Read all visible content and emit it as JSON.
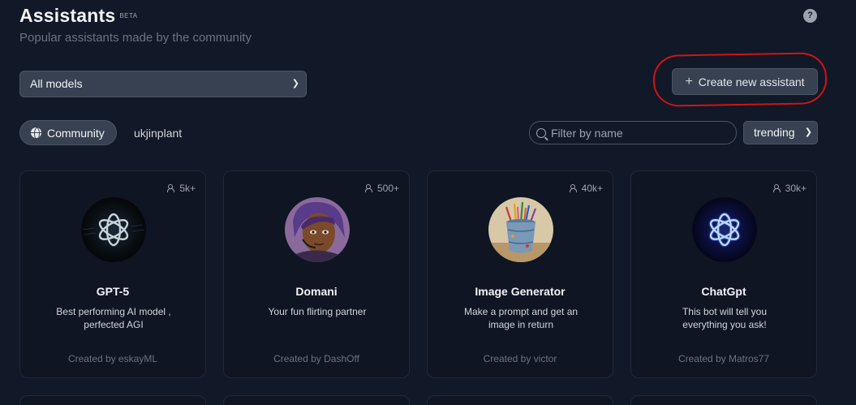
{
  "header": {
    "title": "Assistants",
    "beta": "BETA",
    "subtitle": "Popular assistants made by the community",
    "help_icon": "question-circle-icon"
  },
  "toolbar": {
    "models_select": "All models",
    "create_label": "Create new assistant"
  },
  "tabs": {
    "community": "Community",
    "user": "ukjinplant"
  },
  "filter": {
    "placeholder": "Filter by name",
    "sort": "trending"
  },
  "colors": {
    "background": "#111827",
    "card": "#0f1523",
    "annotation": "#d11414"
  },
  "assistants": [
    {
      "count": "5k+",
      "name": "GPT-5",
      "desc": "Best performing AI model , perfected AGI",
      "by": "Created by eskayML",
      "avatar": "openai-logo-dark"
    },
    {
      "count": "500+",
      "name": "Domani",
      "desc": "Your fun flirting partner",
      "by": "Created by DashOff",
      "avatar": "woman-portrait-headset"
    },
    {
      "count": "40k+",
      "name": "Image Generator",
      "desc": "Make a prompt and get an image in return",
      "by": "Created by victor",
      "avatar": "paint-bucket-brushes"
    },
    {
      "count": "30k+",
      "name": "ChatGpt",
      "desc": "This bot will tell you everything you ask!",
      "by": "Created by Matros77",
      "avatar": "openai-logo-blue-glow"
    }
  ]
}
